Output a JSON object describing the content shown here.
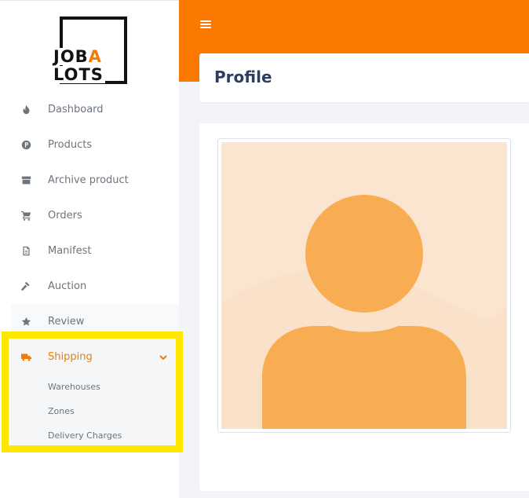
{
  "logo": {
    "line1": "JOB",
    "line1_accent": "A",
    "line2": "LOTS"
  },
  "colors": {
    "accent": "#fb7901",
    "highlight": "#ffe800",
    "title": "#2e3f5e",
    "nav_text": "#6c757d"
  },
  "sidebar": {
    "items": [
      {
        "label": "Dashboard",
        "icon": "fire-icon"
      },
      {
        "label": "Products",
        "icon": "product-badge-icon"
      },
      {
        "label": "Archive product",
        "icon": "archive-box-icon"
      },
      {
        "label": "Orders",
        "icon": "cart-icon"
      },
      {
        "label": "Manifest",
        "icon": "document-icon"
      },
      {
        "label": "Auction",
        "icon": "gavel-icon"
      },
      {
        "label": "Review",
        "icon": "star-icon"
      },
      {
        "label": "Shipping",
        "icon": "truck-icon",
        "expanded": true
      }
    ],
    "shipping_subitems": [
      {
        "label": "Warehouses"
      },
      {
        "label": "Zones"
      },
      {
        "label": "Delivery Charges"
      }
    ]
  },
  "header": {
    "menu_icon": "hamburger-icon"
  },
  "page": {
    "title": "Profile",
    "avatar_icon": "user-placeholder-icon"
  }
}
